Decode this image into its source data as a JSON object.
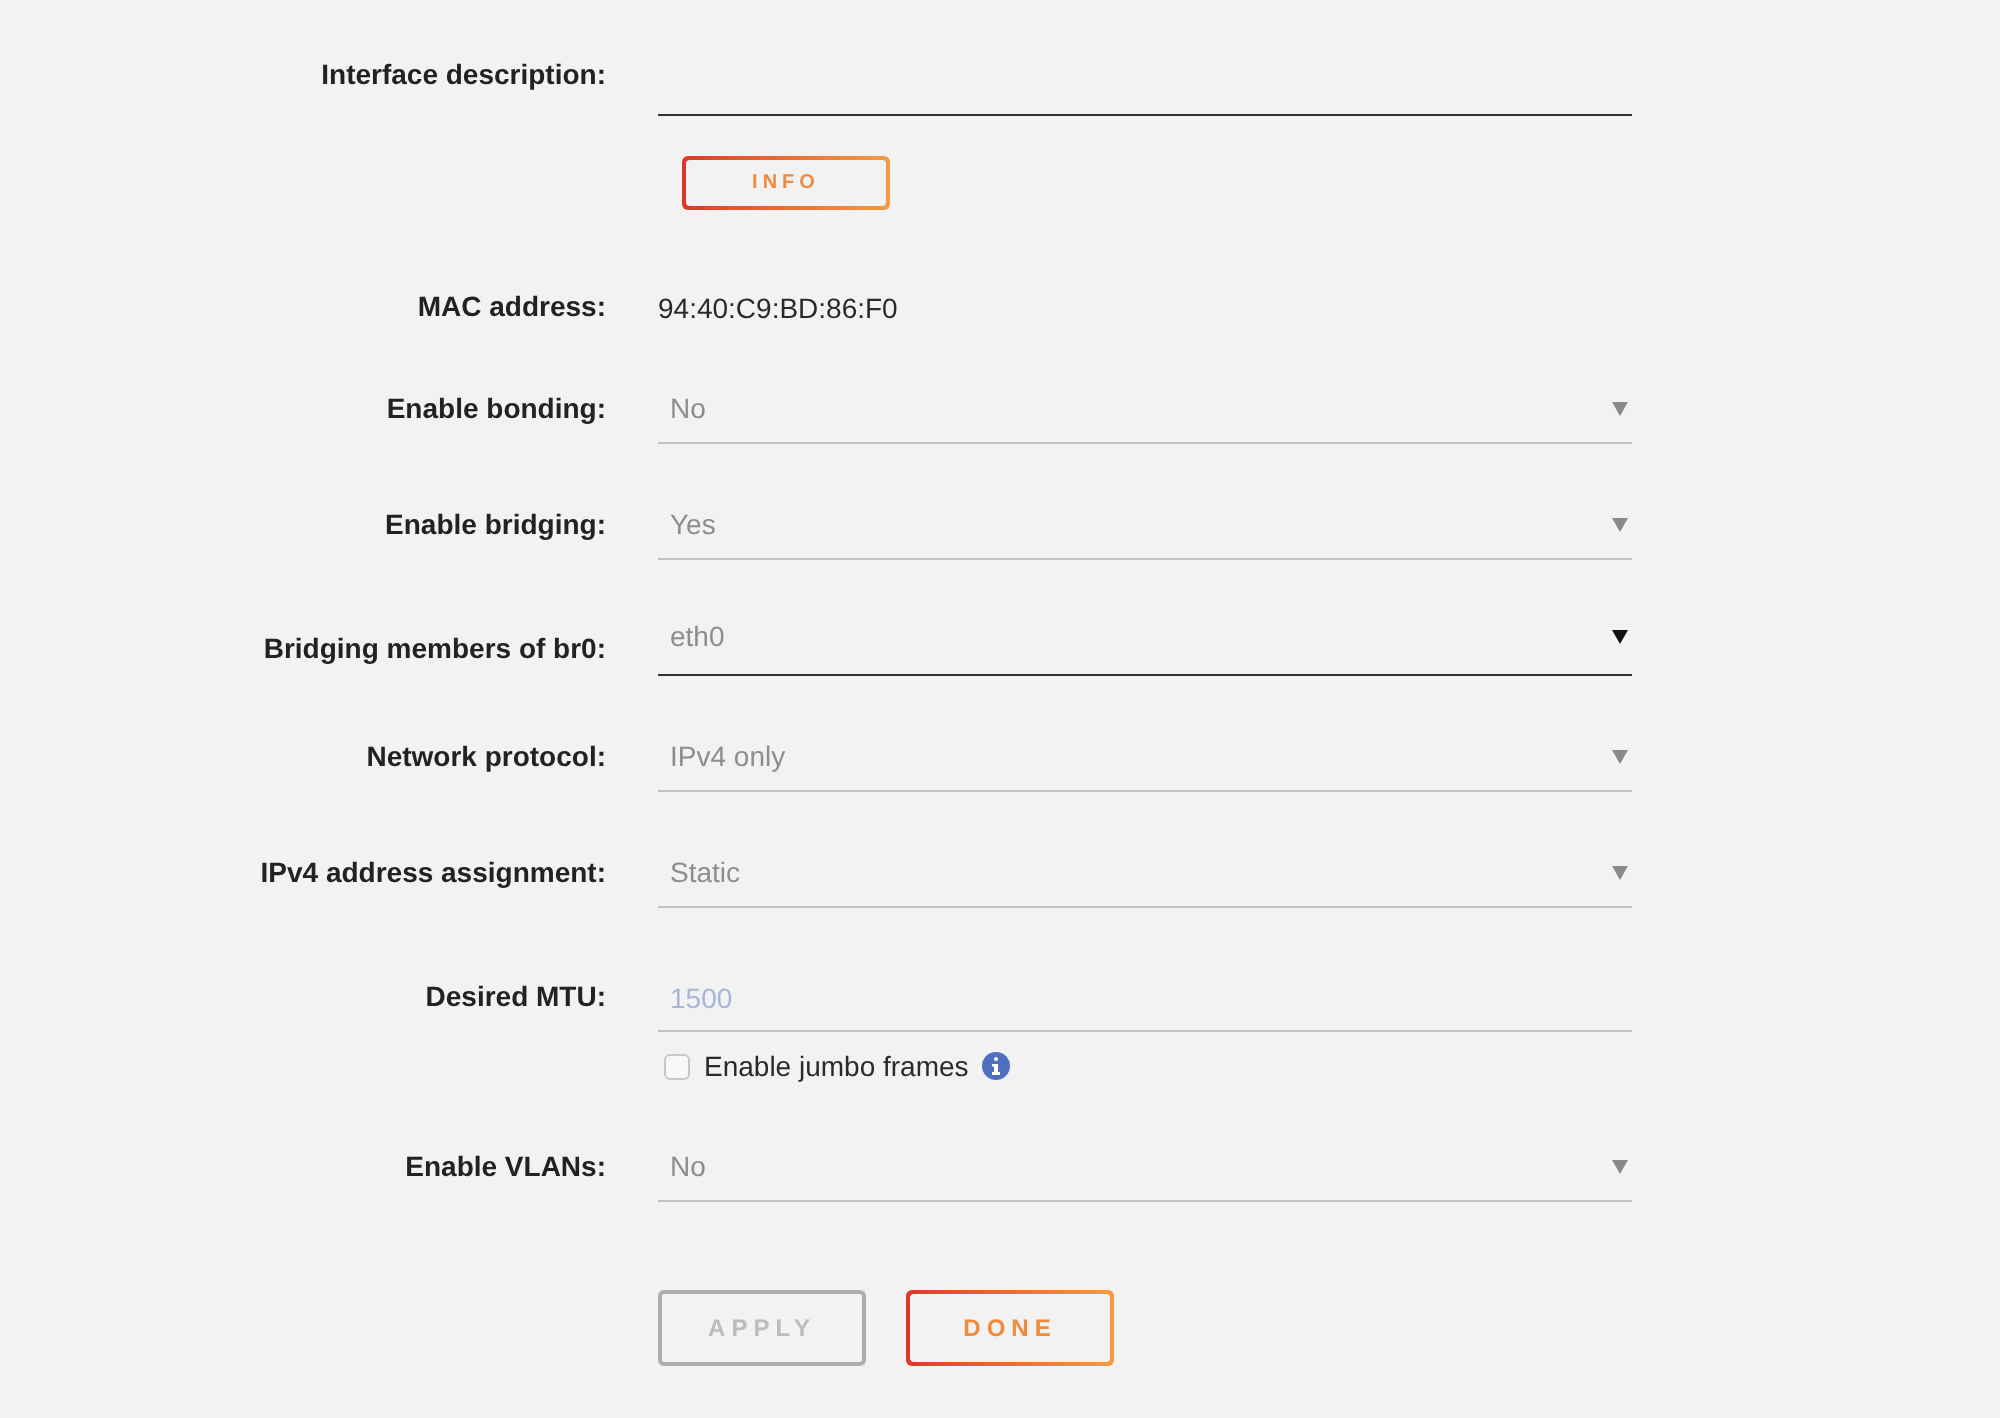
{
  "form": {
    "rows": [
      {
        "kind": "text",
        "label": "Interface description:",
        "focused": true
      },
      {
        "kind": "button",
        "text": "INFO"
      },
      {
        "kind": "static",
        "label": "MAC address:",
        "value": "94:40:C9:BD:86:F0"
      },
      {
        "kind": "select",
        "label": "Enable bonding:",
        "value": "No",
        "focused": false
      },
      {
        "kind": "select",
        "label": "Enable bridging:",
        "value": "Yes",
        "focused": false
      },
      {
        "kind": "select",
        "label": "Bridging members of br0:",
        "value": "eth0",
        "focused": true
      },
      {
        "kind": "select",
        "label": "Network protocol:",
        "value": "IPv4 only",
        "focused": false
      },
      {
        "kind": "select",
        "label": "IPv4 address assignment:",
        "value": "Static",
        "focused": false
      },
      {
        "kind": "number",
        "label": "Desired MTU:",
        "placeholder": "1500",
        "focused": false,
        "checkbox": {
          "label": "Enable jumbo frames",
          "checked": false
        }
      },
      {
        "kind": "select",
        "label": "Enable VLANs:",
        "value": "No",
        "focused": false
      }
    ]
  },
  "buttons": [
    {
      "label": "APPLY",
      "disabled": true
    },
    {
      "label": "DONE",
      "disabled": false
    }
  ]
}
